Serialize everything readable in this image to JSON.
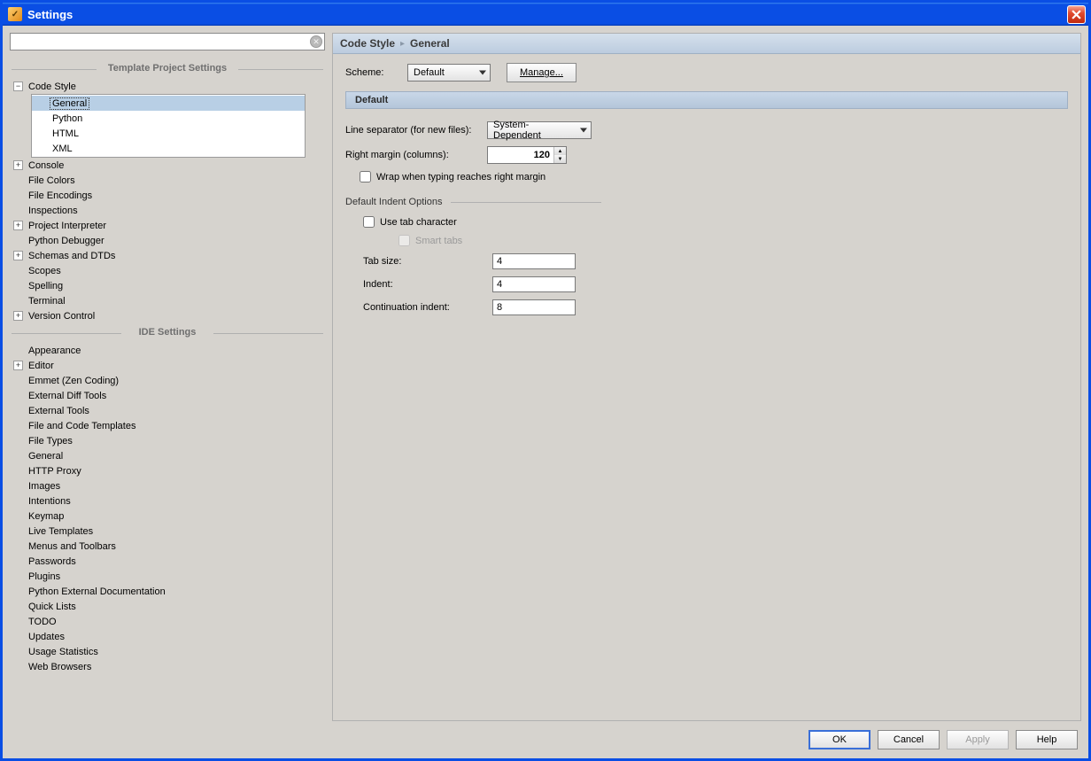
{
  "window": {
    "title": "Settings"
  },
  "search": {
    "placeholder": ""
  },
  "tree": {
    "section1_title": "Template Project Settings",
    "section2_title": "IDE Settings",
    "code_style": {
      "label": "Code Style",
      "children": [
        {
          "label": "General",
          "selected": true
        },
        {
          "label": "Python"
        },
        {
          "label": "HTML"
        },
        {
          "label": "XML"
        }
      ]
    },
    "project_items": [
      {
        "label": "Console",
        "expandable": true
      },
      {
        "label": "File Colors"
      },
      {
        "label": "File Encodings"
      },
      {
        "label": "Inspections"
      },
      {
        "label": "Project Interpreter",
        "expandable": true
      },
      {
        "label": "Python Debugger"
      },
      {
        "label": "Schemas and DTDs",
        "expandable": true
      },
      {
        "label": "Scopes"
      },
      {
        "label": "Spelling"
      },
      {
        "label": "Terminal"
      },
      {
        "label": "Version Control",
        "expandable": true
      }
    ],
    "ide_items": [
      {
        "label": "Appearance"
      },
      {
        "label": "Editor",
        "expandable": true
      },
      {
        "label": "Emmet (Zen Coding)"
      },
      {
        "label": "External Diff Tools"
      },
      {
        "label": "External Tools"
      },
      {
        "label": "File and Code Templates"
      },
      {
        "label": "File Types"
      },
      {
        "label": "General"
      },
      {
        "label": "HTTP Proxy"
      },
      {
        "label": "Images"
      },
      {
        "label": "Intentions"
      },
      {
        "label": "Keymap"
      },
      {
        "label": "Live Templates"
      },
      {
        "label": "Menus and Toolbars"
      },
      {
        "label": "Passwords"
      },
      {
        "label": "Plugins"
      },
      {
        "label": "Python External Documentation"
      },
      {
        "label": "Quick Lists"
      },
      {
        "label": "TODO"
      },
      {
        "label": "Updates"
      },
      {
        "label": "Usage Statistics"
      },
      {
        "label": "Web Browsers"
      }
    ]
  },
  "breadcrumb": {
    "root": "Code Style",
    "leaf": "General"
  },
  "scheme": {
    "label": "Scheme:",
    "value": "Default",
    "manage_label": "Manage..."
  },
  "section_default": "Default",
  "fields": {
    "line_sep_label": "Line separator (for new files):",
    "line_sep_value": "System-Dependent",
    "right_margin_label": "Right margin (columns):",
    "right_margin_value": "120",
    "wrap_label": "Wrap when typing reaches right margin",
    "indent_header": "Default Indent Options",
    "use_tab_label": "Use tab character",
    "smart_tabs_label": "Smart tabs",
    "tab_size_label": "Tab size:",
    "tab_size_value": "4",
    "indent_label": "Indent:",
    "indent_value": "4",
    "cont_indent_label": "Continuation indent:",
    "cont_indent_value": "8"
  },
  "buttons": {
    "ok": "OK",
    "cancel": "Cancel",
    "apply": "Apply",
    "help": "Help"
  }
}
